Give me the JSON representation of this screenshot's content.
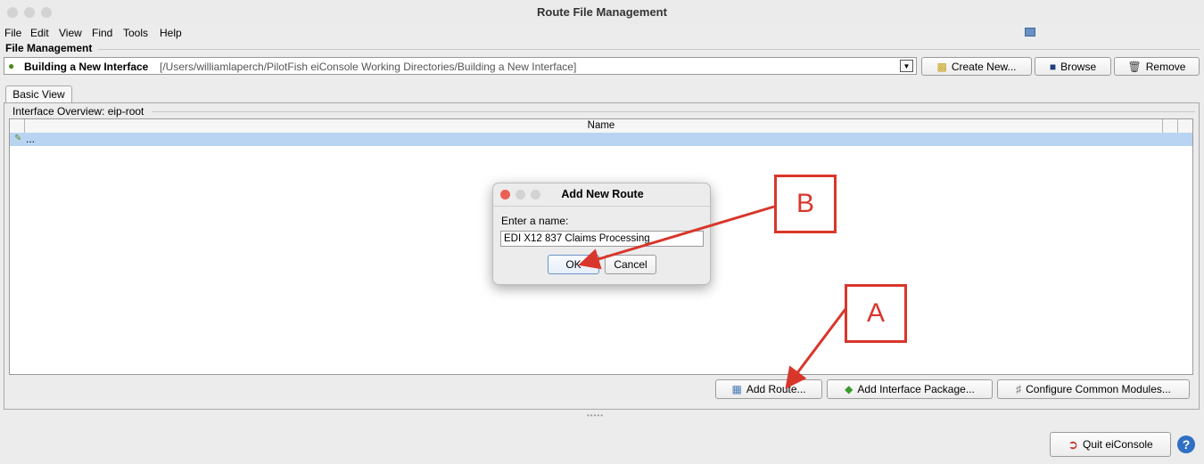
{
  "window": {
    "title": "Route File Management"
  },
  "menu": [
    "File",
    "Edit",
    "View",
    "Find",
    "Tools",
    "Help"
  ],
  "file_management": {
    "group_label": "File Management",
    "interface_name": "Building a New Interface",
    "interface_path": "[/Users/williamlaperch/PilotFish eiConsole Working Directories/Building a New Interface]",
    "create_label": "Create New...",
    "browse_label": "Browse",
    "remove_label": "Remove"
  },
  "tabs": {
    "basic_view": "Basic View"
  },
  "overview": {
    "label": "Interface Overview: eip-root",
    "column_name": "Name",
    "rows": [
      "..."
    ]
  },
  "actions": {
    "add_route": "Add Route...",
    "add_package": "Add Interface Package...",
    "configure_modules": "Configure Common Modules..."
  },
  "dialog": {
    "title": "Add New Route",
    "prompt": "Enter a name:",
    "value": "EDI X12 837 Claims Processing",
    "ok": "OK",
    "cancel": "Cancel"
  },
  "callouts": {
    "a": "A",
    "b": "B"
  },
  "footer": {
    "quit_label": "Quit eiConsole",
    "help": "?"
  },
  "colors": {
    "accent": "#d9362b",
    "selection": "#b9d4f3"
  }
}
